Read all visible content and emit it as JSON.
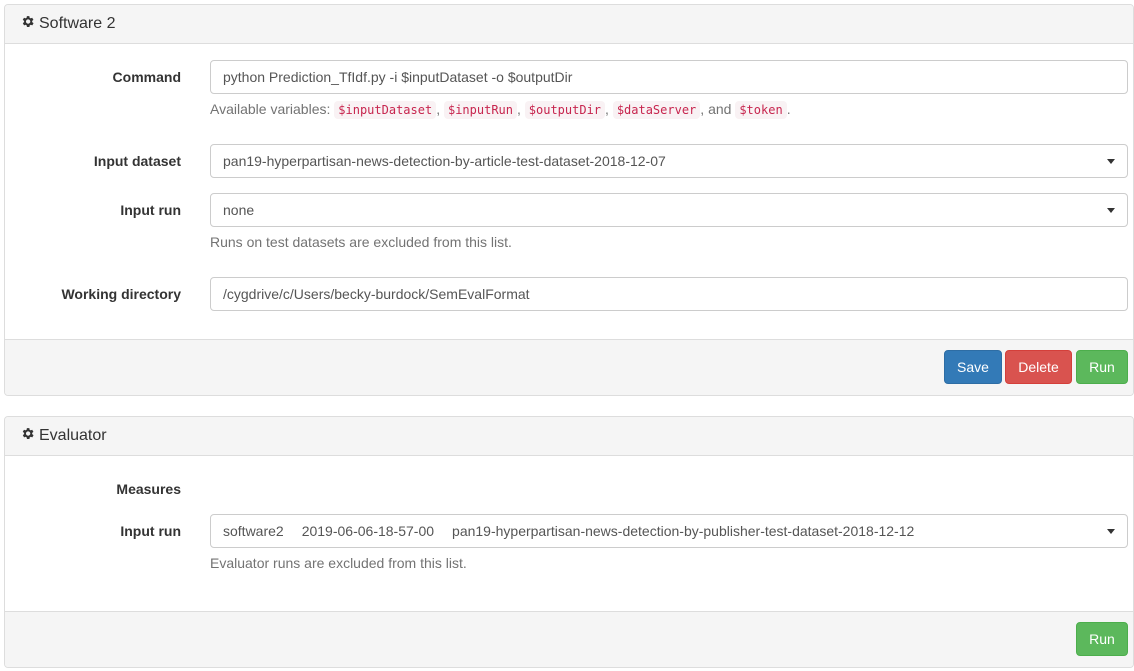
{
  "software_panel": {
    "title": "Software 2",
    "command": {
      "label": "Command",
      "value": "python Prediction_TfIdf.py -i $inputDataset -o $outputDir",
      "help_prefix": "Available variables: ",
      "variables": [
        "$inputDataset",
        "$inputRun",
        "$outputDir",
        "$dataServer",
        "$token"
      ],
      "sep_comma": ",",
      "sep_and": ", and",
      "help_suffix": "."
    },
    "input_dataset": {
      "label": "Input dataset",
      "value": "pan19-hyperpartisan-news-detection-by-article-test-dataset-2018-12-07"
    },
    "input_run": {
      "label": "Input run",
      "value": "none",
      "help": "Runs on test datasets are excluded from this list."
    },
    "working_directory": {
      "label": "Working directory",
      "value": "/cygdrive/c/Users/becky-burdock/SemEvalFormat"
    },
    "buttons": {
      "save": "Save",
      "delete": "Delete",
      "run": "Run"
    }
  },
  "evaluator_panel": {
    "title": "Evaluator",
    "measures_label": "Measures",
    "input_run": {
      "label": "Input run",
      "value_software": "software2",
      "value_timestamp": "2019-06-06-18-57-00",
      "value_dataset": "pan19-hyperpartisan-news-detection-by-publisher-test-dataset-2018-12-12",
      "help": "Evaluator runs are excluded from this list."
    },
    "buttons": {
      "run": "Run"
    }
  },
  "colors": {
    "primary": "#337ab7",
    "danger": "#d9534f",
    "success": "#5cb85c",
    "code_text": "#c7254e",
    "code_bg": "#f9f2f4"
  }
}
